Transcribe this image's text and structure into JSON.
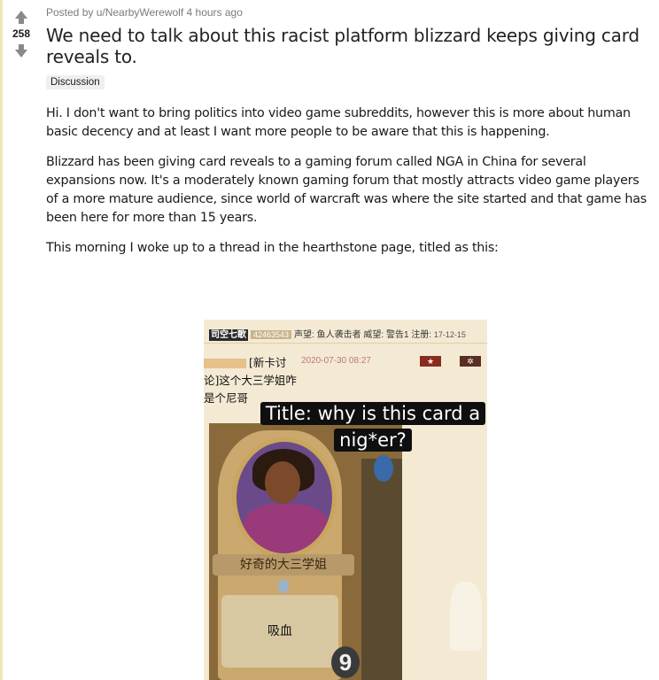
{
  "post": {
    "score": "258",
    "meta": "Posted by u/NearbyWerewolf 4 hours ago",
    "title": "We need to talk about this racist platform blizzard keeps giving card reveals to.",
    "flair": "Discussion",
    "paragraphs": [
      "Hi. I don't want to bring politics into video game subreddits, however this is more about human basic decency and at least I want more people to be aware that this is happening.",
      "Blizzard has been giving card reveals to a gaming forum called NGA in China for several expansions now. It's a moderately known gaming forum that mostly attracts video game players of a more mature audience, since world of warcraft was where the site started and that game has been here for more than 15 years.",
      "This morning I woke up to a thread in the hearthstone page, titled as this:"
    ]
  },
  "image": {
    "header_name": "司空七歌",
    "header_uid": "42463543",
    "header_rest": "声望: 鱼人袭击者 威望: 警告1 注册:",
    "header_date": "17-12-15",
    "thread_title": "[新卡讨论]这个大三学姐咋是个尼哥",
    "thread_date": "2020-07-30 08:27",
    "star_icon": "★",
    "gear_icon": "✲",
    "caption": "Title: why is this card a nig*er?",
    "card_banner": "好奇的大三学姐",
    "card_text": "吸血",
    "card_stat": "9"
  }
}
